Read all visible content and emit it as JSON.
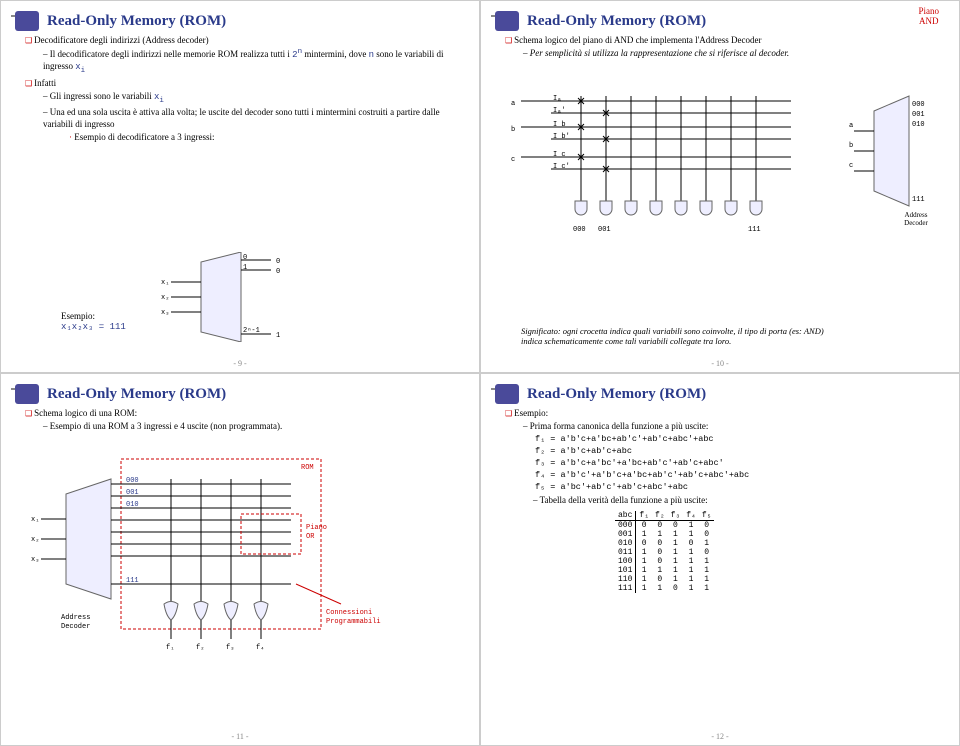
{
  "slides": {
    "s9": {
      "title": "Read-Only Memory (ROM)",
      "b1": "Decodificatore degli indirizzi (Address decoder)",
      "b1a_pre": "Il decodificatore degli indirizzi nelle memorie ROM realizza tutti i ",
      "b1a_exp": "2",
      "b1a_sup": "n",
      "b1a_post": " mintermini, dove ",
      "b1a_n": "n",
      "b1a_end": " sono le variabili di ingresso ",
      "b1a_xi": "x",
      "b1a_i": "i",
      "b2": "Infatti",
      "b2a": "Gli ingressi sono le variabili ",
      "b2b": "Una ed una sola uscita è attiva alla volta; le uscite del decoder sono tutti i mintermini costruiti a partire dalle variabili di ingresso",
      "b2b1": "Esempio di decodificatore a 3 ingressi:",
      "esempio_lbl": "Esempio:",
      "esempio_eq_l": "x₁x₂x₃",
      "esempio_eq_r": " = 111",
      "x1": "x₁",
      "x2": "x₂",
      "x3": "x₃",
      "out0": "0",
      "out1": "0",
      "outL": "1",
      "sub0": "0",
      "sub1": "1",
      "subN": "2ⁿ-1",
      "page": "- 9 -"
    },
    "s10": {
      "title": "Read-Only Memory (ROM)",
      "piano1": "Piano",
      "piano2": "AND",
      "b1": "Schema logico del piano di AND che implementa l'Address Decoder",
      "b1a": "Per semplicità si utilizza la rappresentazione che si riferisce al decoder.",
      "in_a": "a",
      "in_b": "b",
      "in_c": "c",
      "la": "Iₐ",
      "lap": "Iₐ'",
      "lb": "I_b",
      "lbp": "I_b'",
      "lc": "I_c",
      "lcp": "I_c'",
      "c000": "000",
      "c001": "001",
      "c111": "111",
      "c010": "010",
      "addr": "Address\nDecoder",
      "sig": "Significato: ogni crocetta indica quali variabili sono coinvolte, il tipo di porta (es: AND) indica schematicamente come tali variabili collegate tra loro.",
      "page": "- 10 -"
    },
    "s11": {
      "title": "Read-Only Memory (ROM)",
      "b1": "Schema logico di una ROM:",
      "b1a": "Esempio di una ROM a 3 ingressi e 4 uscite (non programmata).",
      "x1": "x₁",
      "x2": "x₂",
      "x3": "x₃",
      "addr": "Address\nDecoder",
      "c000": "000",
      "c001": "001",
      "c010": "010",
      "c111": "111",
      "romlbl": "ROM",
      "piano": "Piano\nOR",
      "conn": "Connessioni\nProgrammabili",
      "f1": "f₁",
      "f2": "f₂",
      "f3": "f₃",
      "f4": "f₄",
      "page": "- 11 -"
    },
    "s12": {
      "title": "Read-Only Memory (ROM)",
      "b1": "Esempio:",
      "b1a": "Prima forma canonica della funzione a più uscite:",
      "f1": "f₁ = a'b'c+a'bc+ab'c'+ab'c+abc'+abc",
      "f2": "f₂ = a'b'c+ab'c+abc",
      "f3": "f₃ = a'b'c+a'bc'+a'bc+ab'c'+ab'c+abc'",
      "f4": "f₄ = a'b'c'+a'b'c+a'bc+ab'c'+ab'c+abc'+abc",
      "f5": "f₅ = a'bc'+ab'c'+ab'c+abc'+abc",
      "b1b": "Tabella della verità della funzione a più uscite:",
      "page": "- 12 -",
      "th": [
        "abc",
        "f₁",
        "f₂",
        "f₃",
        "f₄",
        "f₅"
      ],
      "rows": [
        [
          "000",
          "0",
          "0",
          "0",
          "1",
          "0"
        ],
        [
          "001",
          "1",
          "1",
          "1",
          "1",
          "0"
        ],
        [
          "010",
          "0",
          "0",
          "1",
          "0",
          "1"
        ],
        [
          "011",
          "1",
          "0",
          "1",
          "1",
          "0"
        ],
        [
          "100",
          "1",
          "0",
          "1",
          "1",
          "1"
        ],
        [
          "101",
          "1",
          "1",
          "1",
          "1",
          "1"
        ],
        [
          "110",
          "1",
          "0",
          "1",
          "1",
          "1"
        ],
        [
          "111",
          "1",
          "1",
          "0",
          "1",
          "1"
        ]
      ]
    }
  }
}
